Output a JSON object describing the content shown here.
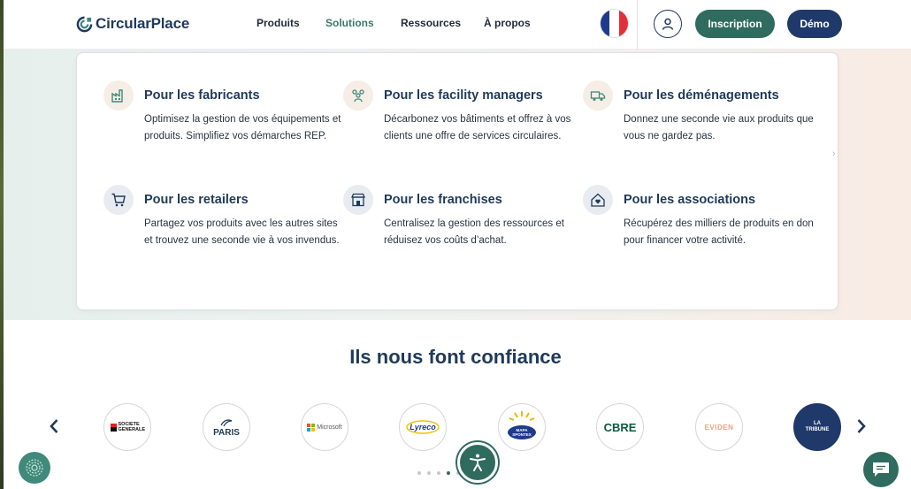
{
  "brand": {
    "name": "CircularPlace"
  },
  "nav": {
    "items": [
      {
        "label": "Produits",
        "active": false
      },
      {
        "label": "Solutions",
        "active": true
      },
      {
        "label": "Ressources",
        "active": false
      },
      {
        "label": "À propos",
        "active": false
      }
    ]
  },
  "header": {
    "language_icon": "french-flag-icon",
    "account_icon": "user-icon",
    "signup_label": "Inscription",
    "demo_label": "Démo"
  },
  "solutions_menu": {
    "items": [
      {
        "title": "Pour les fabricants",
        "description": "Optimisez la gestion de vos équipements et produits. Simplifiez vos démarches REP.",
        "icon": "factory-icon"
      },
      {
        "title": "Pour les facility managers",
        "description": "Décarbonez vos bâtiments et offrez à vos clients une offre de services circulaires.",
        "icon": "team-icon"
      },
      {
        "title": "Pour les déménagements",
        "description": "Donnez une seconde vie aux produits que vous ne gardez pas.",
        "icon": "truck-icon"
      },
      {
        "title": "Pour les retailers",
        "description": "Partagez vos produits avec les autres sites et trouvez une seconde vie à vos invendus.",
        "icon": "cart-icon"
      },
      {
        "title": "Pour les franchises",
        "description": "Centralisez la gestion des ressources et réduisez vos coûts d’achat.",
        "icon": "storefront-icon"
      },
      {
        "title": "Pour les associations",
        "description": "Récupérez des milliers de produits en don pour financer votre activité.",
        "icon": "home-heart-icon"
      }
    ]
  },
  "trust": {
    "title": "Ils nous font confiance",
    "logos": [
      {
        "name": "SOCIETE GENERALE",
        "text": "SOCIETE GENERALE"
      },
      {
        "name": "Ville de Paris",
        "text": "PARIS"
      },
      {
        "name": "Microsoft",
        "text": "Microsoft"
      },
      {
        "name": "Lyreco",
        "text": "Lyreco"
      },
      {
        "name": "Mapa Spontex",
        "text": "MAPA SPONTEX"
      },
      {
        "name": "CBRE",
        "text": "CBRE"
      },
      {
        "name": "Eviden",
        "text": "EVIDEN"
      },
      {
        "name": "La Tribune",
        "text": "LA TRIBUNE"
      }
    ],
    "prev_icon": "chevron-left-icon",
    "next_icon": "chevron-right-icon",
    "active_slide": 4,
    "slide_count": 5
  },
  "widgets": {
    "left_badge_icon": "fingerprint-icon",
    "accessibility_icon": "accessibility-icon",
    "chat_icon": "chat-icon"
  },
  "colors": {
    "primary_green": "#2f6b5e",
    "navy": "#1f3a6a",
    "text_dark": "#1f3a5a",
    "active_nav": "#3a7a6a"
  }
}
